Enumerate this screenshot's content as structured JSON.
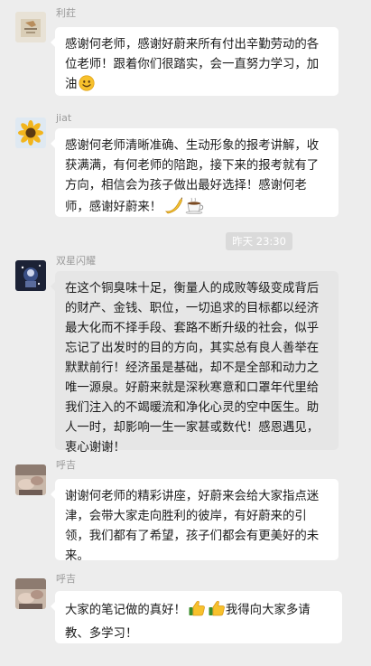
{
  "messages": [
    {
      "sender": "利荭",
      "text": "感谢何老师，感谢好蔚来所有付出辛勤劳动的各位老师！跟着你们很踏实，会一直努力学习，加油",
      "emoji": [
        "smiling-face-emoji"
      ]
    },
    {
      "sender": "jiat",
      "text": "感谢何老师清晰准确、生动形象的报考讲解，收获满满，有何老师的陪跑，接下来的报考就有了方向，相信会为孩子做出最好选择！感谢何老师，感谢好蔚来！",
      "emoji": [
        "banana-emoji",
        "coffee-emoji"
      ]
    },
    {
      "sender": "双星闪耀",
      "text": "在这个铜臭味十足，衡量人的成败等级变成背后的财产、金钱、职位，一切追求的目标都以经济最大化而不择手段、套路不断升级的社会，似乎忘记了出发时的目的方向，其实总有良人善举在默默前行！经济虽是基础，却不是全部和动力之唯一源泉。好蔚来就是深秋寒意和口罩年代里给我们注入的不竭暖流和净化心灵的空中医生。助人一时，却影响一生一家甚或数代！感恩遇见，衷心谢谢！",
      "emoji": []
    },
    {
      "sender": "呼吉",
      "text": "谢谢何老师的精彩讲座，好蔚来会给大家指点迷津，会带大家走向胜利的彼岸，有好蔚来的引领，我们都有了希望，孩子们都会有更美好的未来。",
      "emoji": []
    },
    {
      "sender": "呼吉",
      "text_before": "大家的笔记做的真好！",
      "text_after": "我得向大家多请教、多学习！",
      "emoji": [
        "thumbs-up-emoji",
        "thumbs-up-emoji"
      ]
    }
  ],
  "timestamp": "昨天 23:30",
  "colors": {
    "background": "#ededed",
    "bubble": "#ffffff",
    "bubble_highlighted": "#e6e6e6",
    "sender": "#9a9a9a",
    "timestamp_bg": "#dadada"
  }
}
